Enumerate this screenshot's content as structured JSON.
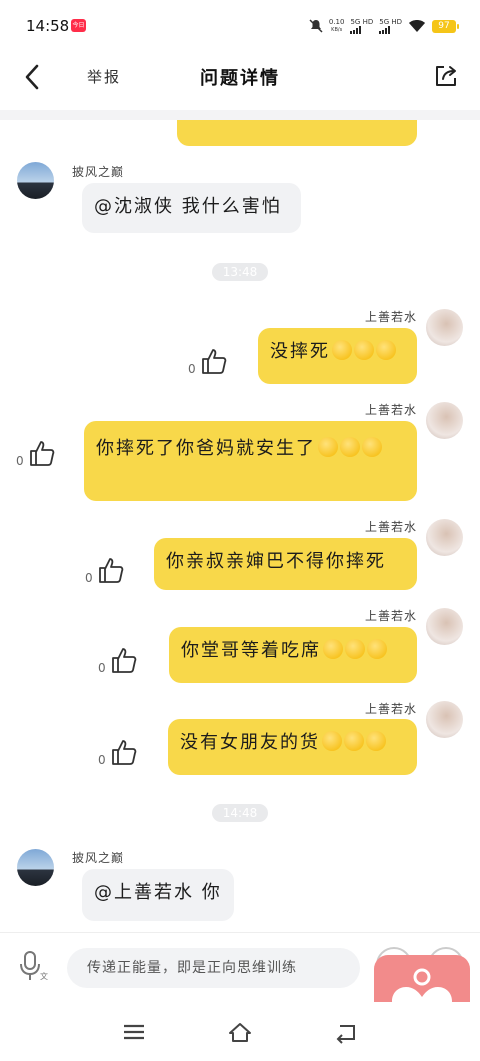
{
  "status_bar": {
    "time": "14:58",
    "app_badge": "今日",
    "net_speed": "0.10",
    "net_unit": "KB/s",
    "sim1": "5G HD",
    "sim2": "5G HD",
    "battery": "97"
  },
  "header": {
    "report_label": "举报",
    "title": "问题详情"
  },
  "messages": [
    {
      "sender": "披风之巅",
      "text": "@沈淑侠 我什么害怕"
    },
    {
      "timestamp": "13:48"
    },
    {
      "sender": "上善若水",
      "text": "没摔死",
      "likes": "0"
    },
    {
      "sender": "上善若水",
      "text": "你摔死了你爸妈就安生了",
      "likes": "0"
    },
    {
      "sender": "上善若水",
      "text": "你亲叔亲婶巴不得你摔死",
      "likes": "0"
    },
    {
      "sender": "上善若水",
      "text": "你堂哥等着吃席",
      "likes": "0"
    },
    {
      "sender": "上善若水",
      "text": "没有女朋友的货",
      "likes": "0"
    },
    {
      "timestamp": "14:48"
    },
    {
      "sender": "披风之巅",
      "text": "@上善若水 你"
    }
  ],
  "input": {
    "placeholder": "传递正能量，即是正向思维训练",
    "voice_mode_label": "文"
  },
  "colors": {
    "my_bubble": "#f8d84a",
    "other_bubble": "#f1f2f4",
    "heart_button": "#f28b8b"
  }
}
